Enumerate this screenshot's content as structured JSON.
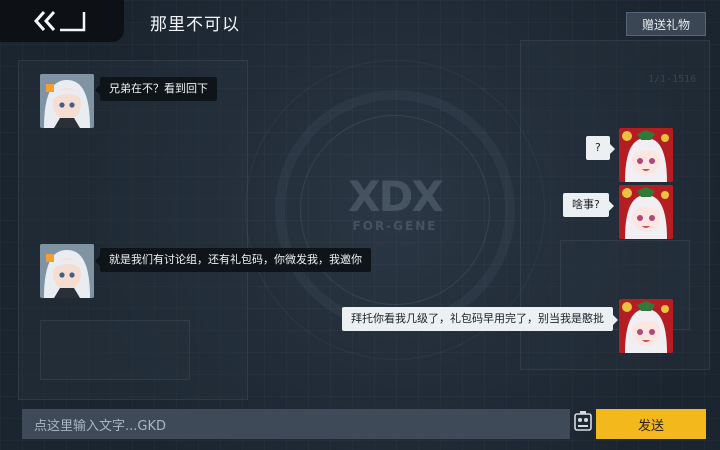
{
  "header": {
    "title": "那里不可以",
    "gift_button_label": "赠送礼物"
  },
  "messages": [
    {
      "side": "left",
      "text": "兄弟在不？看到回下",
      "avatar": "silver-hair-girl"
    },
    {
      "side": "right",
      "text": "?",
      "avatar": "christmas-girl"
    },
    {
      "side": "right",
      "text": "啥事?",
      "avatar": "christmas-girl"
    },
    {
      "side": "left",
      "text": "就是我们有讨论组，还有礼包码，你微发我，我邀你",
      "avatar": "silver-hair-girl"
    },
    {
      "side": "right",
      "text": "拜托你看我几级了，礼包码早用完了，别当我是憨批",
      "avatar": "christmas-girl"
    }
  ],
  "input": {
    "placeholder": "点这里输入文字...GKD",
    "send_label": "发送"
  },
  "background": {
    "logo_text": "FOR-GENE"
  },
  "colors": {
    "accent": "#f2b81c",
    "background": "#1c2530",
    "bubble_left": "#0f1419",
    "bubble_right": "#edf0f2"
  }
}
